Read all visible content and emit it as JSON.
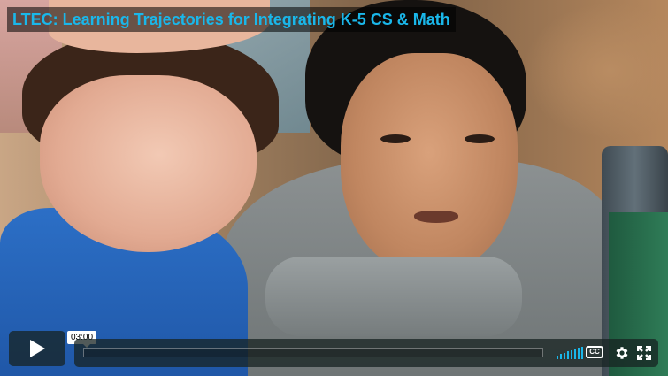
{
  "video": {
    "title": "LTEC: Learning Trajectories for Integrating K-5 CS & Math",
    "time_tooltip": "03:00",
    "progress_fraction": 0.0
  },
  "controls": {
    "play_icon": "play-icon",
    "volume_icon": "volume-icon",
    "cc_icon": "closed-captions-icon",
    "cc_label": "CC",
    "settings_icon": "gear-icon",
    "fullscreen_icon": "fullscreen-icon"
  },
  "colors": {
    "accent": "#1ab7ea",
    "control_bg": "#172322"
  }
}
